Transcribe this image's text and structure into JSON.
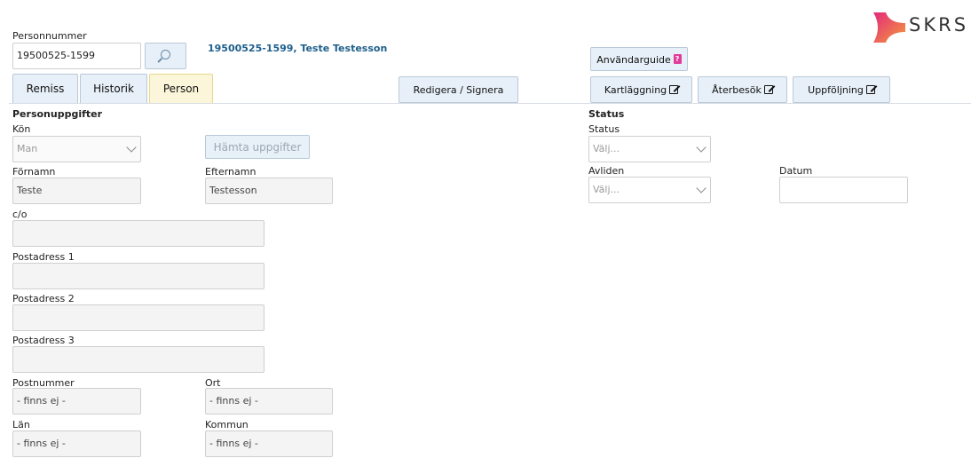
{
  "header": {
    "personnummer_label": "Personnummer",
    "personnummer_value": "19500525-1599",
    "patient_title": "19500525-1599, Teste Testesson",
    "guide_button": "Användarguide",
    "logo_text": "SKRS"
  },
  "tabs": [
    {
      "label": "Remiss"
    },
    {
      "label": "Historik"
    },
    {
      "label": "Person"
    }
  ],
  "actions": {
    "redigera": "Redigera / Signera",
    "kartlaggning": "Kartläggning",
    "aterbesok": "Återbesök",
    "uppfoljning": "Uppföljning"
  },
  "person": {
    "section_title": "Personuppgifter",
    "kon_label": "Kön",
    "kon_value": "Man",
    "hamta_button": "Hämta uppgifter",
    "fornamn_label": "Förnamn",
    "fornamn_value": "Teste",
    "efternamn_label": "Efternamn",
    "efternamn_value": "Testesson",
    "co_label": "c/o",
    "postadress1_label": "Postadress 1",
    "postadress2_label": "Postadress 2",
    "postadress3_label": "Postadress 3",
    "postnummer_label": "Postnummer",
    "postnummer_value": "- finns ej -",
    "ort_label": "Ort",
    "ort_value": "- finns ej -",
    "lan_label": "Län",
    "lan_value": "- finns ej -",
    "kommun_label": "Kommun",
    "kommun_value": "- finns ej -"
  },
  "status": {
    "section_title": "Status",
    "status_label": "Status",
    "status_placeholder": "Välj...",
    "avliden_label": "Avliden",
    "avliden_placeholder": "Välj...",
    "datum_label": "Datum"
  },
  "colors": {
    "accent": "#1f5f8b",
    "tab_bg": "#e7f0f8",
    "active_tab_bg": "#fbf6d9",
    "logo_pink": "#e4287c",
    "logo_orange": "#f39c3a"
  }
}
